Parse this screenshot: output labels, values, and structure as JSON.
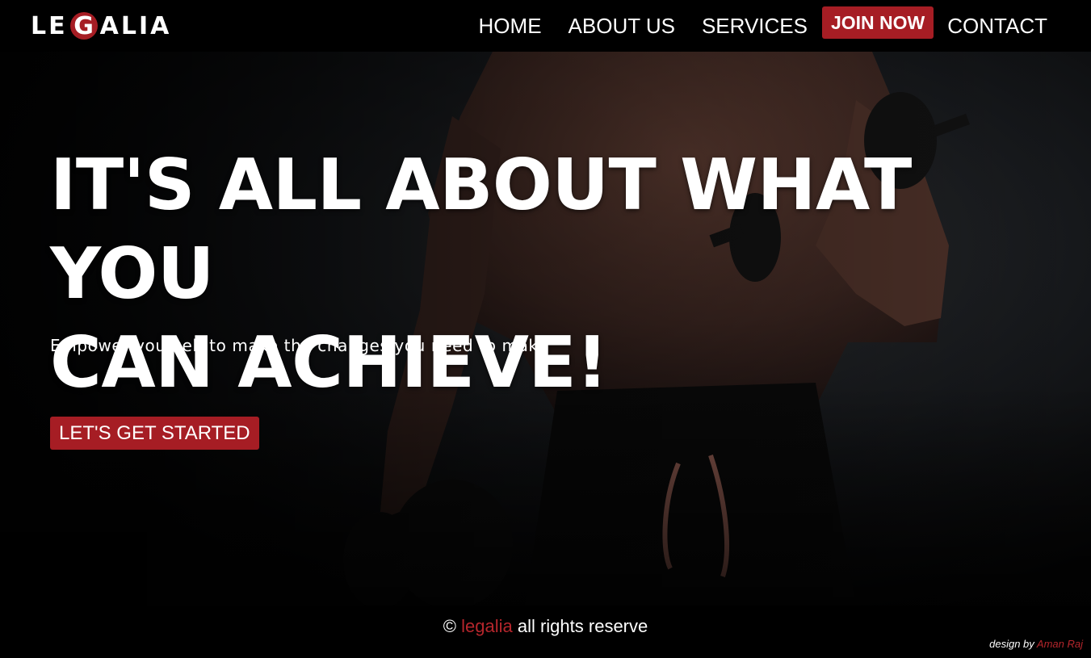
{
  "header": {
    "logo": {
      "prefix": "LE",
      "highlight": "G",
      "suffix": "ALIA"
    },
    "nav": [
      {
        "label": "HOME"
      },
      {
        "label": "ABOUT US"
      },
      {
        "label": "SERVICES"
      },
      {
        "label": "JOIN NOW"
      },
      {
        "label": "CONTACT"
      }
    ]
  },
  "hero": {
    "title_line1": "IT'S ALL ABOUT WHAT YOU",
    "title_line2": "CAN ACHIEVE!",
    "subtitle": "Empower yourself to make the changes you need to make",
    "cta_label": "LET'S GET STARTED"
  },
  "footer": {
    "copyright_symbol": "©",
    "brand": "legalia",
    "rights": "all rights reserve",
    "credit_prefix": "design by",
    "credit_author": "Aman Raj"
  },
  "colors": {
    "accent": "#a61d24",
    "background": "#000000",
    "text": "#ffffff"
  }
}
